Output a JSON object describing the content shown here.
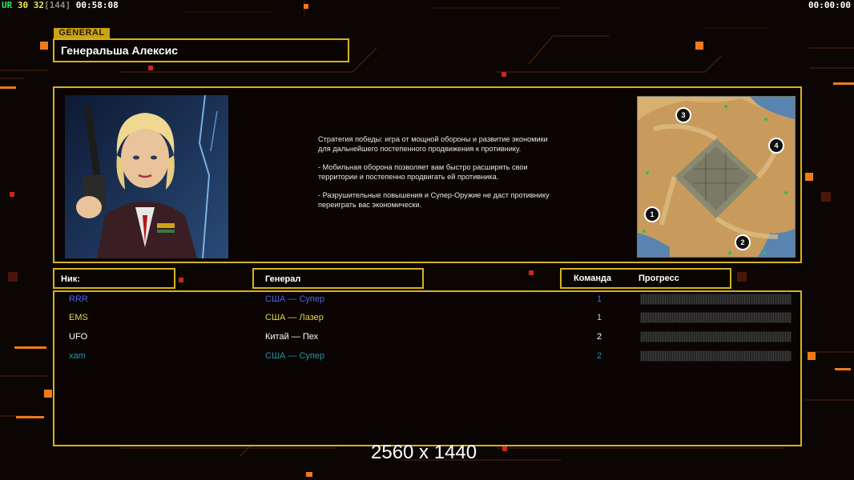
{
  "hud": {
    "left_parts": [
      {
        "text": "UR",
        "color": "#2ee56b"
      },
      {
        "text": " 30",
        "color": "#f2e84a"
      },
      {
        "text": " 32",
        "color": "#f2e84a"
      },
      {
        "text": "[144]",
        "color": "#8a8a8a"
      },
      {
        "text": " 00:58:08",
        "color": "#ffffff"
      }
    ],
    "right_timer": "00:00:00"
  },
  "general_tag": "GENERAL",
  "general_name": "Генеральша Алексис",
  "description": [
    "Стратегия победы: игра от мощной обороны и развитие экономики для дальнейшего постепенного продвижения к противнику.",
    "- Мобильная оборона позволяет вам быстро расширять свои территории и постепенно продвигать ей противника.",
    "- Разрушительные повышения и Супер-Оружие не даст противнику переиграть вас экономически."
  ],
  "minimap": {
    "start_positions": [
      "3",
      "4",
      "1",
      "2"
    ]
  },
  "headers": {
    "nick": "Ник:",
    "general": "Генерал",
    "team": "Команда",
    "progress": "Прогресс"
  },
  "players": [
    {
      "nick": "RRR",
      "general": "США — Супер",
      "team": "1",
      "color": "#4f66e3"
    },
    {
      "nick": "EMS",
      "general": "США — Лазер",
      "team": "1",
      "color": "#e3d54a"
    },
    {
      "nick": "UFO",
      "general": "Китай — Пех",
      "team": "2",
      "color": "#ffffff"
    },
    {
      "nick": "xam",
      "general": "США — Супер",
      "team": "2",
      "color": "#1f9aa0"
    }
  ],
  "resolution_label": "2560 x 1440",
  "colors": {
    "frame_gold": "#d4b21f",
    "accent_orange": "#f07a1a"
  }
}
